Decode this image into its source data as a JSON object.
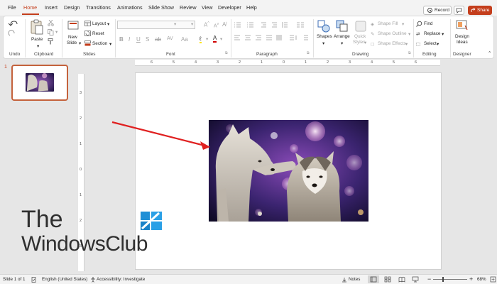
{
  "menu": {
    "tabs": [
      "File",
      "Home",
      "Insert",
      "Design",
      "Transitions",
      "Animations",
      "Slide Show",
      "Review",
      "View",
      "Developer",
      "Help"
    ],
    "active_tab": "Home",
    "record_label": "Record",
    "share_label": "Share"
  },
  "ribbon": {
    "groups": {
      "undo": "Undo",
      "clipboard": "Clipboard",
      "slides": "Slides",
      "font": "Font",
      "paragraph": "Paragraph",
      "drawing": "Drawing",
      "editing": "Editing",
      "designer": "Designer"
    },
    "clipboard": {
      "paste": "Paste"
    },
    "slides": {
      "new_slide_1": "New",
      "new_slide_2": "Slide",
      "layout": "Layout",
      "reset": "Reset",
      "section": "Section"
    },
    "drawing": {
      "shapes": "Shapes",
      "arrange": "Arrange",
      "quick_styles_1": "Quick",
      "quick_styles_2": "Styles",
      "shape_fill": "Shape Fill",
      "shape_outline": "Shape Outline",
      "shape_effects": "Shape Effects"
    },
    "editing": {
      "find": "Find",
      "replace": "Replace",
      "select": "Select"
    },
    "designer": {
      "design_ideas_1": "Design",
      "design_ideas_2": "Ideas"
    }
  },
  "thumbnails": {
    "slide_number": "1"
  },
  "ruler": {
    "h_labels": [
      "6",
      "5",
      "4",
      "3",
      "2",
      "1",
      "0",
      "1",
      "2",
      "3",
      "4",
      "5",
      "6"
    ],
    "v_labels": [
      "3",
      "2",
      "1",
      "0",
      "1",
      "2",
      "3"
    ]
  },
  "watermark": {
    "line1": "The",
    "line2": "WindowsClub"
  },
  "statusbar": {
    "slide_info": "Slide 1 of 1",
    "language": "English (United States)",
    "accessibility": "Accessibility: Investigate",
    "notes": "Notes",
    "zoom": "68%"
  },
  "colors": {
    "accent": "#c43e1c",
    "arrow": "#e02020",
    "share_bg": "#c43e1c"
  }
}
